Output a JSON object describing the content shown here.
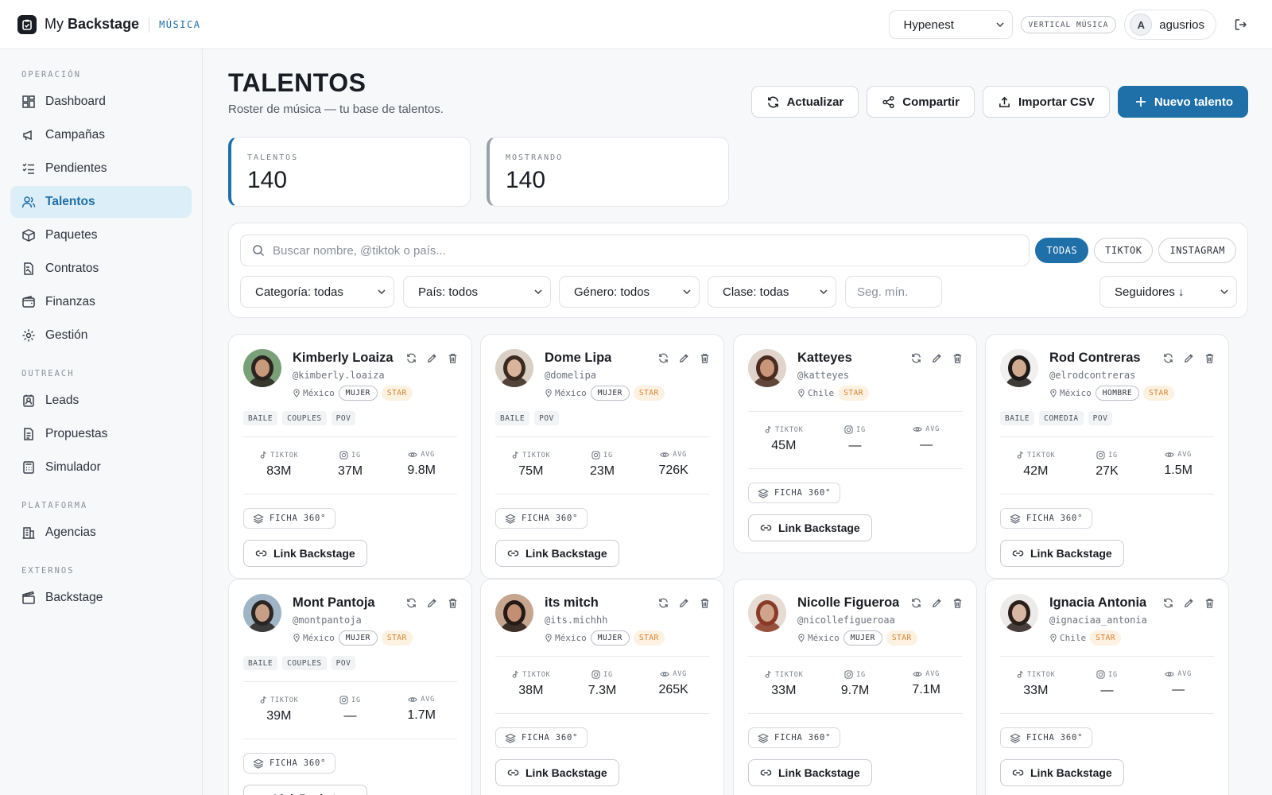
{
  "brand": {
    "name_pre": "My",
    "name_bold": "Backstage",
    "tag": "MÚSICA"
  },
  "topbar": {
    "org": "Hypenest",
    "vertical": "VERTICAL MÚSICA",
    "avatar_letter": "A",
    "user": "agusrios"
  },
  "sidebar": {
    "sections": [
      {
        "label": "OPERACIÓN",
        "items": [
          {
            "label": "Dashboard",
            "icon": "grid-icon"
          },
          {
            "label": "Campañas",
            "icon": "megaphone-icon"
          },
          {
            "label": "Pendientes",
            "icon": "checklist-icon"
          },
          {
            "label": "Talentos",
            "icon": "users-icon",
            "active": true
          },
          {
            "label": "Paquetes",
            "icon": "package-icon"
          },
          {
            "label": "Contratos",
            "icon": "contract-icon"
          },
          {
            "label": "Finanzas",
            "icon": "wallet-icon"
          },
          {
            "label": "Gestión",
            "icon": "gear-icon"
          }
        ]
      },
      {
        "label": "OUTREACH",
        "items": [
          {
            "label": "Leads",
            "icon": "contact-icon"
          },
          {
            "label": "Propuestas",
            "icon": "document-icon"
          },
          {
            "label": "Simulador",
            "icon": "calculator-icon"
          }
        ]
      },
      {
        "label": "PLATAFORMA",
        "items": [
          {
            "label": "Agencias",
            "icon": "building-icon"
          }
        ]
      },
      {
        "label": "EXTERNOS",
        "items": [
          {
            "label": "Backstage",
            "icon": "clapper-icon"
          }
        ]
      }
    ]
  },
  "page": {
    "title": "TALENTOS",
    "subtitle": "Roster de música — tu base de talentos."
  },
  "actions": {
    "refresh": "Actualizar",
    "share": "Compartir",
    "import": "Importar CSV",
    "new": "Nuevo talento"
  },
  "stats": {
    "talentos_label": "TALENTOS",
    "talentos_value": "140",
    "mostrando_label": "MOSTRANDO",
    "mostrando_value": "140"
  },
  "filters": {
    "search_placeholder": "Buscar nombre, @tiktok o país...",
    "platforms": [
      "TODAS",
      "TIKTOK",
      "INSTAGRAM"
    ],
    "active_platform": "TODAS",
    "categoria": "Categoría: todas",
    "pais": "País: todos",
    "genero": "Género: todos",
    "clase": "Clase: todas",
    "seg_min_placeholder": "Seg. mín.",
    "sort": "Seguidores ↓"
  },
  "card_labels": {
    "tiktok": "TIKTOK",
    "ig": "IG",
    "avg": "AVG",
    "ficha": "FICHA 360°",
    "link": "Link Backstage"
  },
  "talents": [
    {
      "name": "Kimberly Loaiza",
      "handle": "@kimberly.loaiza",
      "country": "México",
      "gender": "MUJER",
      "class": "STAR",
      "tags": [
        "BAILE",
        "COUPLES",
        "POV"
      ],
      "tiktok": "83M",
      "ig": "37M",
      "avg": "9.8M",
      "skin": "#c89a7c",
      "hair": "#2b2420",
      "bg": "#7aa07a"
    },
    {
      "name": "Dome Lipa",
      "handle": "@domelipa",
      "country": "México",
      "gender": "MUJER",
      "class": "STAR",
      "tags": [
        "BAILE",
        "POV"
      ],
      "tiktok": "75M",
      "ig": "23M",
      "avg": "726K",
      "skin": "#d8b49a",
      "hair": "#3a2a22",
      "bg": "#d9cfc4"
    },
    {
      "name": "Katteyes",
      "handle": "@katteyes",
      "country": "Chile",
      "gender": "",
      "class": "STAR",
      "tags": [],
      "tiktok": "45M",
      "ig": "—",
      "avg": "—",
      "skin": "#c9967a",
      "hair": "#4a2d20",
      "bg": "#e0d4cc"
    },
    {
      "name": "Rod Contreras",
      "handle": "@elrodcontreras",
      "country": "México",
      "gender": "HOMBRE",
      "class": "STAR",
      "tags": [
        "BAILE",
        "COMEDIA",
        "POV"
      ],
      "tiktok": "42M",
      "ig": "27K",
      "avg": "1.5M",
      "skin": "#d1ab90",
      "hair": "#1f1a17",
      "bg": "#f0f0f0"
    },
    {
      "name": "Mont Pantoja",
      "handle": "@montpantoja",
      "country": "México",
      "gender": "MUJER",
      "class": "STAR",
      "tags": [
        "BAILE",
        "COUPLES",
        "POV"
      ],
      "tiktok": "39M",
      "ig": "—",
      "avg": "1.7M",
      "skin": "#c79f86",
      "hair": "#2a2623",
      "bg": "#9fb4c4"
    },
    {
      "name": "its mitch",
      "handle": "@its.michhh",
      "country": "México",
      "gender": "MUJER",
      "class": "STAR",
      "tags": [],
      "tiktok": "38M",
      "ig": "7.3M",
      "avg": "265K",
      "skin": "#c48e72",
      "hair": "#241b17",
      "bg": "#c7a690"
    },
    {
      "name": "Nicolle Figueroa",
      "handle": "@nicollefigueroaa",
      "country": "México",
      "gender": "MUJER",
      "class": "STAR",
      "tags": [],
      "tiktok": "33M",
      "ig": "9.7M",
      "avg": "7.1M",
      "skin": "#d0a48a",
      "hair": "#8a3a26",
      "bg": "#e7dcd4"
    },
    {
      "name": "Ignacia Antonia",
      "handle": "@ignaciaa_antonia",
      "country": "Chile",
      "gender": "",
      "class": "STAR",
      "tags": [],
      "tiktok": "33M",
      "ig": "—",
      "avg": "—",
      "skin": "#d8b8a4",
      "hair": "#2b201c",
      "bg": "#ecebea"
    }
  ]
}
